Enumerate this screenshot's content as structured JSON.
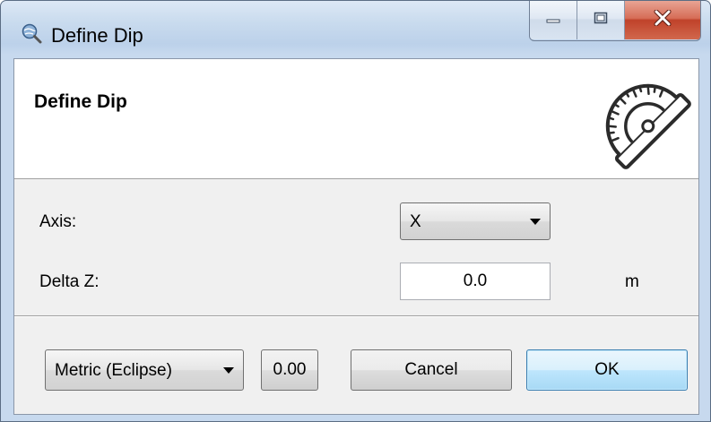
{
  "window": {
    "title": "Define Dip",
    "icon": "magnifier-globe-icon",
    "caption": {
      "minimize": "minimize-icon",
      "maximize": "maximize-icon",
      "close": "close-icon"
    }
  },
  "header": {
    "title": "Define Dip",
    "icon": "protractor-icon"
  },
  "form": {
    "axis": {
      "label": "Axis:",
      "value": "X"
    },
    "delta_z": {
      "label": "Delta Z:",
      "value": "0.0",
      "unit": "m"
    }
  },
  "footer": {
    "unit_system": "Metric (Eclipse)",
    "precision": "0.00",
    "cancel_label": "Cancel",
    "ok_label": "OK"
  },
  "colors": {
    "title_bar": "#c9dbee",
    "close_button": "#c0422a",
    "client_background": "#f0f0f0",
    "default_button_border": "#3c7fb1"
  }
}
